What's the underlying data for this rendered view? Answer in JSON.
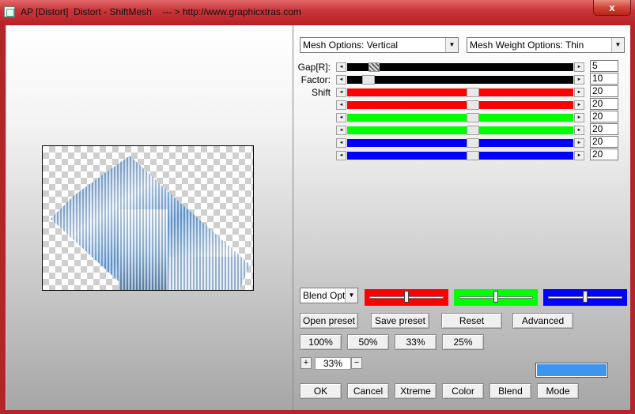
{
  "window": {
    "title": "AP [Distort]  Distort - ShiftMesh    --- > http://www.graphicxtras.com",
    "close_label": "x"
  },
  "controls": {
    "mesh_options": "Mesh Options: Vertical",
    "mesh_weight": "Mesh Weight Options: Thin",
    "labels": {
      "gap": "Gap[R]:",
      "factor": "Factor:",
      "shift": "Shift"
    },
    "sliders": [
      {
        "id": "gap",
        "value": "5",
        "color": "#000000",
        "position": 0.1
      },
      {
        "id": "factor",
        "value": "10",
        "color": "#000000",
        "position": 0.07
      },
      {
        "id": "shift-red-1",
        "value": "20",
        "color": "#ff0000",
        "position": 0.56
      },
      {
        "id": "shift-red-2",
        "value": "20",
        "color": "#ff0000",
        "position": 0.56
      },
      {
        "id": "shift-green-1",
        "value": "20",
        "color": "#00ff00",
        "position": 0.56
      },
      {
        "id": "shift-green-2",
        "value": "20",
        "color": "#00ff00",
        "position": 0.56
      },
      {
        "id": "shift-blue-1",
        "value": "20",
        "color": "#0000ff",
        "position": 0.56
      },
      {
        "id": "shift-blue-2",
        "value": "20",
        "color": "#0000ff",
        "position": 0.56
      }
    ]
  },
  "blend": {
    "options_label": "Blend Optio",
    "sliders": [
      {
        "color": "#ff0000",
        "position": 0.5
      },
      {
        "color": "#00ff00",
        "position": 0.5
      },
      {
        "color": "#0000ff",
        "position": 0.5
      }
    ]
  },
  "buttons": {
    "open_preset": "Open preset",
    "save_preset": "Save preset",
    "reset": "Reset",
    "advanced": "Advanced",
    "zoom_100": "100%",
    "zoom_50": "50%",
    "zoom_33": "33%",
    "zoom_25": "25%",
    "plus": "+",
    "minus": "−",
    "ok": "OK",
    "cancel": "Cancel",
    "xtreme": "Xtreme",
    "color": "Color",
    "blend": "Blend",
    "mode": "Mode"
  },
  "zoom": {
    "value": "33%"
  },
  "swatch": {
    "color": "#3d95f0"
  }
}
